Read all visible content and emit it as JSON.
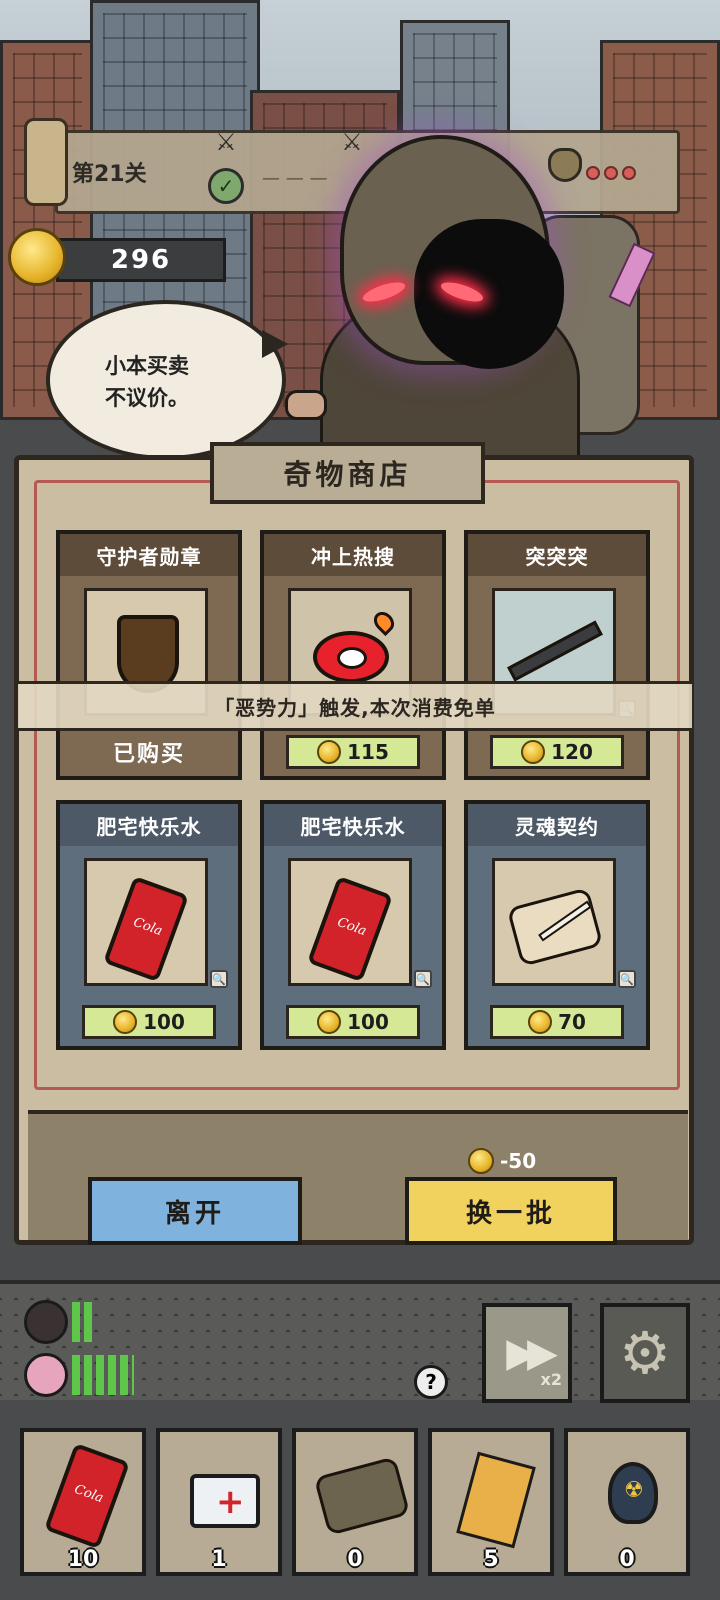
{
  "hud": {
    "level_label": "第21关",
    "coins": "296",
    "stage_icons": [
      "crossed-swords-icon",
      "crossed-swords-icon",
      "check-icon"
    ],
    "loot_dots": 3
  },
  "merchant": {
    "speech": "小本买卖\n不议价。"
  },
  "shop": {
    "title": "奇物商店",
    "notice": "「恶势力」触发,本次消费免单",
    "items": [
      {
        "name": "守护者勋章",
        "icon": "shield-icon",
        "price": null,
        "status": "已购买",
        "style": "brown"
      },
      {
        "name": "冲上热搜",
        "icon": "weibo-icon",
        "price": "115",
        "status": "",
        "style": "brown"
      },
      {
        "name": "突突突",
        "icon": "rifle-icon",
        "price": "120",
        "status": "",
        "style": "brown"
      },
      {
        "name": "肥宅快乐水",
        "icon": "cola-can-icon",
        "price": "100",
        "status": "",
        "style": "blue"
      },
      {
        "name": "肥宅快乐水",
        "icon": "cola-can-icon",
        "price": "100",
        "status": "",
        "style": "blue"
      },
      {
        "name": "灵魂契约",
        "icon": "scroll-icon",
        "price": "70",
        "status": "",
        "style": "blue"
      }
    ],
    "can_label": "Cola",
    "leave_label": "离开",
    "refresh_label": "换一批",
    "refresh_cost": "-50"
  },
  "controls": {
    "help": "?",
    "speed_label": "x2"
  },
  "inventory": [
    {
      "icon": "cola-can-icon",
      "count": "10"
    },
    {
      "icon": "medkit-icon",
      "count": "1"
    },
    {
      "icon": "scroll-icon",
      "count": "0"
    },
    {
      "icon": "lightning-paper-icon",
      "count": "5"
    },
    {
      "icon": "bomb-icon",
      "count": "0"
    }
  ],
  "colors": {
    "price_bar": "#d5e896",
    "leave_button": "#7fb3dd",
    "refresh_button": "#f2d25e",
    "hp_bar": "#5ec74a"
  }
}
